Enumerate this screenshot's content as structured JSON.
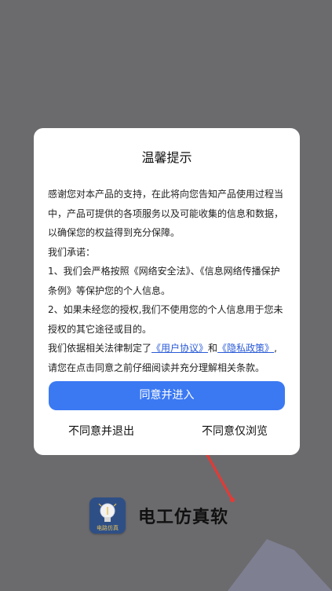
{
  "dialog": {
    "title": "温馨提示",
    "paragraph1": "感谢您对本产品的支持，在此将向您告知产品使用过程当中，产品可提供的各项服务以及可能收集的信息和数据，以确保您的权益得到充分保障。",
    "promise_heading": "我们承诺：",
    "promise1": "1、我们会严格按照《网络安全法》、《信息网络传播保护条例》等保护您的个人信息。",
    "promise2": "2、如果未经您的授权,我们不使用您的个人信息用于您未授权的其它途径或目的。",
    "policy_prefix": "我们依据相关法律制定了",
    "user_agreement_link": "《用户协议》",
    "and_text": "和",
    "privacy_policy_link": "《隐私政策》",
    "policy_suffix": ",请您在点击同意之前仔细阅读并充分理解相关条款。",
    "agree_button": "同意并进入",
    "disagree_exit_button": "不同意并退出",
    "disagree_browse_button": "不同意仅浏览"
  },
  "background": {
    "app_name": "电工仿真软",
    "app_icon_caption": "电路仿真",
    "accent_color": "#3b79f3",
    "arrow_color": "#e53935"
  }
}
